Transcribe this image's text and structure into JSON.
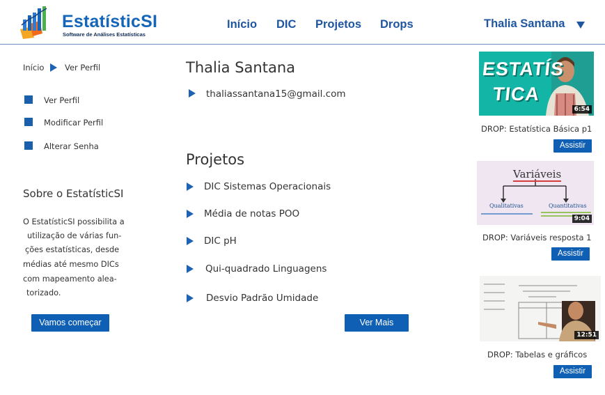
{
  "brand": {
    "name": "EstatísticSI",
    "tagline": "Software de Análises Estatísticas"
  },
  "nav": {
    "items": [
      "Início",
      "DIC",
      "Projetos",
      "Drops"
    ]
  },
  "user": {
    "name": "Thalia Santana"
  },
  "breadcrumb": {
    "home": "Início",
    "current": "Ver Perfil"
  },
  "sidebar": {
    "items": [
      "Ver Perfil",
      "Modificar Perfil",
      "Alterar Senha"
    ]
  },
  "about": {
    "title": "Sobre o EstatísticSI",
    "lines": [
      "O EstatísticSI possibilita a",
      "utilização de várias fun-",
      "ções estatísticas, desde",
      "médias até mesmo DICs",
      "com mapeamento alea-",
      "torizado."
    ],
    "button": "Vamos começar"
  },
  "profile": {
    "name": "Thalia Santana",
    "email": "thaliassantana15@gmail.com"
  },
  "projects": {
    "title": "Projetos",
    "items": [
      "DIC Sistemas Operacionais",
      "Média de notas POO",
      "DIC pH",
      "Qui-quadrado Linguagens",
      "Desvio Padrão Umidade"
    ],
    "more_button": "Ver Mais"
  },
  "drops": [
    {
      "label": "DROP: Estatística Básica p1",
      "duration": "6:54",
      "thumb_text": [
        "ESTATÍS",
        "TICA"
      ],
      "button": "Assistir"
    },
    {
      "label": "DROP: Variáveis resposta 1",
      "duration": "9:04",
      "thumb_text": [
        "Variáveis",
        "Qualitativas",
        "Quantitativas"
      ],
      "button": "Assistir"
    },
    {
      "label": "DROP: Tabelas e gráficos",
      "duration": "12:51",
      "button": "Assistir"
    }
  ],
  "colors": {
    "brand_blue": "#1565b8",
    "button_blue": "#0f5fb5",
    "thumb1_bg": "#13b6a6",
    "thumb2_bg": "#efe6f2"
  }
}
